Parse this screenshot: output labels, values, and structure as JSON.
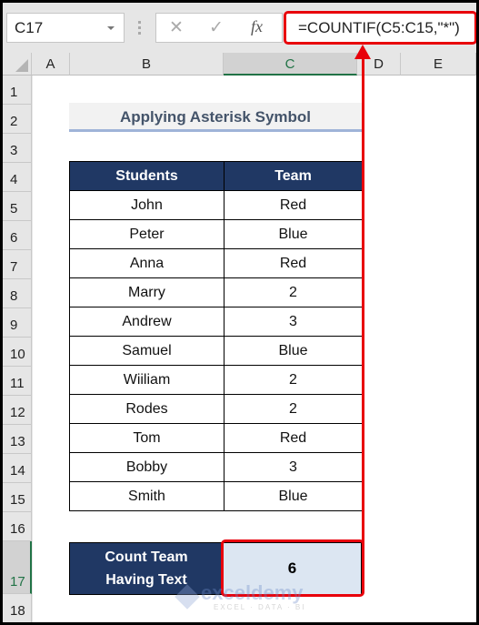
{
  "formula_bar": {
    "name_box": "C17",
    "cancel_icon": "✕",
    "enter_icon": "✓",
    "fx_icon": "fx",
    "formula": "=COUNTIF(C5:C15,\"*\")"
  },
  "columns": [
    "A",
    "B",
    "C",
    "D",
    "E"
  ],
  "selected_column": "C",
  "rows": [
    "1",
    "2",
    "3",
    "4",
    "5",
    "6",
    "7",
    "8",
    "9",
    "10",
    "11",
    "12",
    "13",
    "14",
    "15",
    "16",
    "17",
    "18"
  ],
  "selected_row": "17",
  "sheet": {
    "title": "Applying Asterisk Symbol",
    "table": {
      "headers": [
        "Students",
        "Team"
      ],
      "rows": [
        [
          "John",
          "Red"
        ],
        [
          "Peter",
          "Blue"
        ],
        [
          "Anna",
          "Red"
        ],
        [
          "Marry",
          "2"
        ],
        [
          "Andrew",
          "3"
        ],
        [
          "Samuel",
          "Blue"
        ],
        [
          "Wiiliam",
          "2"
        ],
        [
          "Rodes",
          "2"
        ],
        [
          "Tom",
          "Red"
        ],
        [
          "Bobby",
          "3"
        ],
        [
          "Smith",
          "Blue"
        ]
      ]
    },
    "result": {
      "label_line1": "Count Team",
      "label_line2": "Having Text",
      "value": "6"
    }
  },
  "watermark": {
    "name": "exceldemy",
    "tagline": "EXCEL · DATA · BI"
  },
  "colors": {
    "header_fill": "#203864",
    "result_fill": "#dce6f2",
    "annotation_red": "#e8000b",
    "excel_green": "#217346",
    "title_text": "#44546a"
  }
}
